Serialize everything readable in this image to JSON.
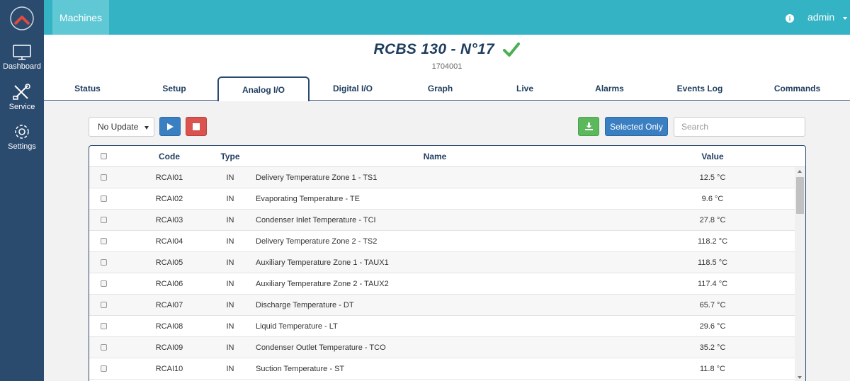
{
  "sidebar": {
    "items": [
      {
        "label": "Dashboard",
        "icon": "monitor-icon"
      },
      {
        "label": "Service",
        "icon": "tools-icon"
      },
      {
        "label": "Settings",
        "icon": "gear-icon"
      }
    ]
  },
  "topbar": {
    "machines_label": "Machines",
    "user_label": "admin"
  },
  "header": {
    "title": "RCBS 130 - N°17",
    "serial": "1704001",
    "status_color": "#4caf50"
  },
  "tabs": [
    {
      "label": "Status"
    },
    {
      "label": "Setup"
    },
    {
      "label": "Analog I/O",
      "active": true
    },
    {
      "label": "Digital I/O"
    },
    {
      "label": "Graph"
    },
    {
      "label": "Live"
    },
    {
      "label": "Alarms"
    },
    {
      "label": "Events Log"
    },
    {
      "label": "Commands"
    }
  ],
  "toolbar": {
    "update_select_value": "No Update",
    "selected_only_label": "Selected Only",
    "search_placeholder": "Search"
  },
  "table": {
    "columns": {
      "code": "Code",
      "type": "Type",
      "name": "Name",
      "value": "Value"
    },
    "rows": [
      {
        "code": "RCAI01",
        "type": "IN",
        "name": "Delivery Temperature Zone 1 - TS1",
        "value": "12.5 °C"
      },
      {
        "code": "RCAI02",
        "type": "IN",
        "name": "Evaporating Temperature - TE",
        "value": "9.6 °C"
      },
      {
        "code": "RCAI03",
        "type": "IN",
        "name": "Condenser Inlet Temperature - TCI",
        "value": "27.8 °C"
      },
      {
        "code": "RCAI04",
        "type": "IN",
        "name": "Delivery Temperature Zone 2 - TS2",
        "value": "118.2 °C"
      },
      {
        "code": "RCAI05",
        "type": "IN",
        "name": "Auxiliary Temperature Zone 1 - TAUX1",
        "value": "118.5 °C"
      },
      {
        "code": "RCAI06",
        "type": "IN",
        "name": "Auxiliary Temperature Zone 2 - TAUX2",
        "value": "117.4 °C"
      },
      {
        "code": "RCAI07",
        "type": "IN",
        "name": "Discharge Temperature - DT",
        "value": "65.7 °C"
      },
      {
        "code": "RCAI08",
        "type": "IN",
        "name": "Liquid Temperature - LT",
        "value": "29.6 °C"
      },
      {
        "code": "RCAI09",
        "type": "IN",
        "name": "Condenser Outlet Temperature - TCO",
        "value": "35.2 °C"
      },
      {
        "code": "RCAI10",
        "type": "IN",
        "name": "Suction Temperature - ST",
        "value": "11.8 °C"
      }
    ]
  }
}
